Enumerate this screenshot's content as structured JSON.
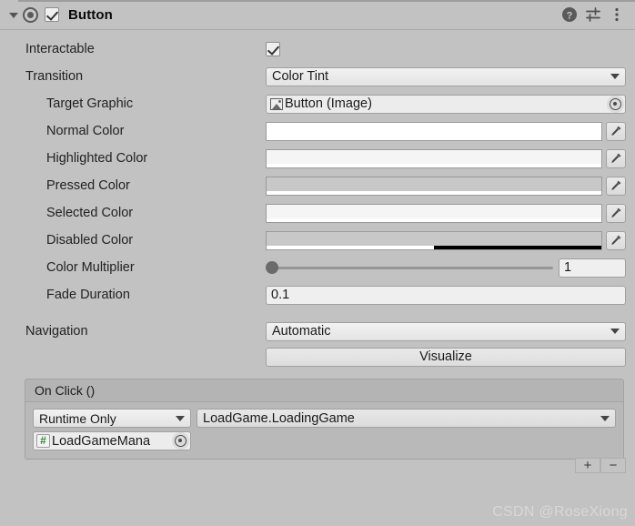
{
  "header": {
    "title": "Button",
    "enabled_checkbox": true,
    "foldout_expanded": true,
    "icons": {
      "foldout": "triangle-down-icon",
      "component": "button-component-icon",
      "help": "help-icon",
      "preset": "preset-icon",
      "menu": "kebab-menu-icon"
    }
  },
  "properties": {
    "interactable": {
      "label": "Interactable",
      "value": true
    },
    "transition": {
      "label": "Transition",
      "value": "Color Tint"
    },
    "target_graphic": {
      "label": "Target Graphic",
      "value": "Button (Image)",
      "icon": "sprite-icon"
    },
    "normal_color": {
      "label": "Normal Color",
      "color": "#FFFFFF",
      "alpha": 100
    },
    "highlighted_color": {
      "label": "Highlighted Color",
      "color": "#F5F5F5",
      "alpha": 100
    },
    "pressed_color": {
      "label": "Pressed Color",
      "color": "#C8C8C8",
      "alpha": 100
    },
    "selected_color": {
      "label": "Selected Color",
      "color": "#F5F5F5",
      "alpha": 100
    },
    "disabled_color": {
      "label": "Disabled Color",
      "color": "#C8C8C8",
      "alpha": 50
    },
    "color_multiplier": {
      "label": "Color Multiplier",
      "value": "1",
      "slider_percent": 0
    },
    "fade_duration": {
      "label": "Fade Duration",
      "value": "0.1"
    },
    "navigation": {
      "label": "Navigation",
      "value": "Automatic"
    },
    "visualize": {
      "label": "Visualize"
    }
  },
  "on_click": {
    "title": "On Click ()",
    "entries": [
      {
        "mode": "Runtime Only",
        "function": "LoadGame.LoadingGame",
        "object": "LoadGameMana",
        "object_icon": "csharp-script-icon"
      }
    ],
    "add_label": "+",
    "remove_label": "−"
  },
  "watermark": "CSDN @RoseXiong",
  "colors": {
    "panel_bg": "#C2C2C2",
    "field_bg": "#EFEFEF",
    "border": "#A0A0A0",
    "script_green": "#2E8B35"
  }
}
